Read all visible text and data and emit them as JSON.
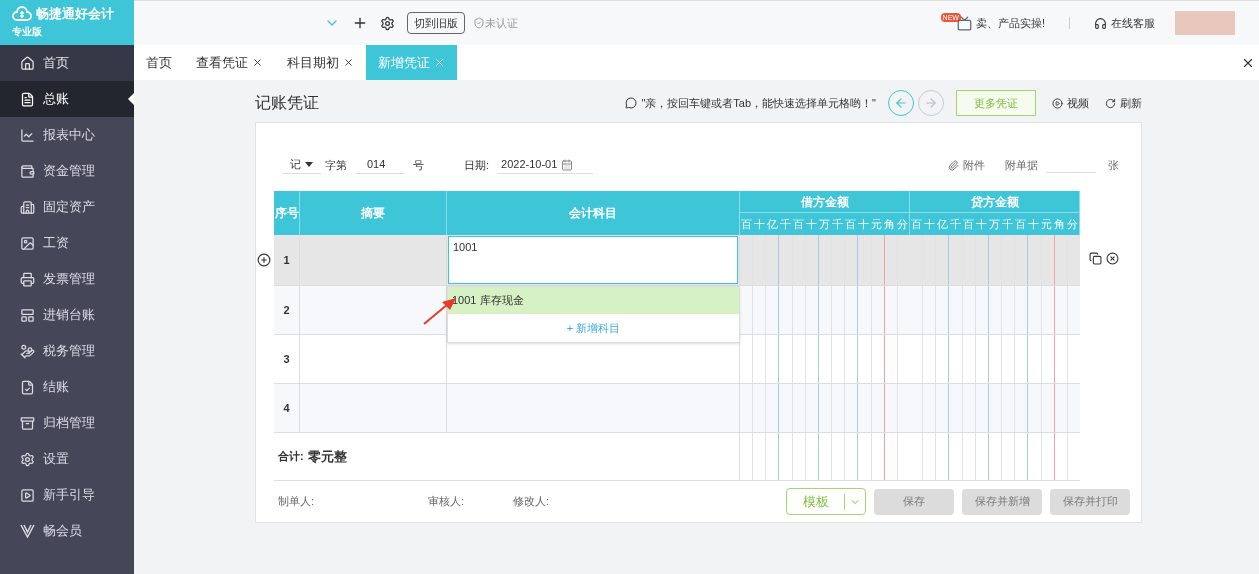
{
  "logo": {
    "name": "畅捷通好会计",
    "edition": "专业版"
  },
  "topbar": {
    "switch_button": "切到旧版",
    "verify": "未认证",
    "promo": "卖、产品实操!",
    "promo_badge": "NEW",
    "support": "在线客服"
  },
  "tabs": [
    {
      "label": "首页",
      "closable": false,
      "selected": false
    },
    {
      "label": "查看凭证",
      "closable": true,
      "selected": false
    },
    {
      "label": "科目期初",
      "closable": true,
      "selected": false
    },
    {
      "label": "新增凭证",
      "closable": true,
      "selected": true
    }
  ],
  "sidebar": {
    "items": [
      {
        "label": "首页",
        "selected": false
      },
      {
        "label": "总账",
        "selected": true
      },
      {
        "label": "报表中心",
        "selected": false
      },
      {
        "label": "资金管理",
        "selected": false
      },
      {
        "label": "固定资产",
        "selected": false
      },
      {
        "label": "工资",
        "selected": false
      },
      {
        "label": "发票管理",
        "selected": false
      },
      {
        "label": "进销台账",
        "selected": false
      },
      {
        "label": "税务管理",
        "selected": false
      },
      {
        "label": "结账",
        "selected": false
      },
      {
        "label": "归档管理",
        "selected": false
      },
      {
        "label": "设置",
        "selected": false
      },
      {
        "label": "新手引导",
        "selected": false
      },
      {
        "label": "畅会员",
        "selected": false
      }
    ]
  },
  "page": {
    "title": "记账凭证",
    "tip": "\"亲，按回车键或者Tab，能快速选择单元格哟！\"",
    "more_button": "更多凭证",
    "video": "视频",
    "refresh": "刷新"
  },
  "voucher": {
    "word": "记",
    "word_label": "字第",
    "number": "014",
    "number_suffix": "号",
    "date_label": "日期:",
    "date": "2022-10-01",
    "attachment": "附件",
    "docs_label": "附单据",
    "docs_unit": "张"
  },
  "table": {
    "columns": [
      "序号",
      "摘要",
      "会计科目"
    ],
    "debit": {
      "title": "借方金额",
      "digits": [
        "百",
        "十",
        "亿",
        "千",
        "百",
        "十",
        "万",
        "千",
        "百",
        "十",
        "元",
        "角",
        "分"
      ]
    },
    "credit": {
      "title": "贷方金额",
      "digits": [
        "百",
        "十",
        "亿",
        "千",
        "百",
        "十",
        "万",
        "千",
        "百",
        "十",
        "元",
        "角",
        "分"
      ]
    },
    "rows": [
      {
        "no": "1",
        "account": "1001",
        "selected": true
      },
      {
        "no": "2",
        "selected": false
      },
      {
        "no": "3",
        "selected": false
      },
      {
        "no": "4",
        "selected": false
      }
    ],
    "dropdown": {
      "options": [
        {
          "label": "1001 库存现金",
          "selected": true
        }
      ],
      "add_label": "+ 新增科目"
    },
    "total": {
      "label": "合计:",
      "value": "零元整"
    }
  },
  "footer": {
    "signatures": [
      "制单人:",
      "审核人:",
      "修改人:"
    ],
    "template_button": "模板",
    "actions": [
      {
        "label": "保存",
        "disabled": true
      },
      {
        "label": "保存并新增",
        "disabled": true
      },
      {
        "label": "保存并打印",
        "disabled": true
      }
    ]
  }
}
